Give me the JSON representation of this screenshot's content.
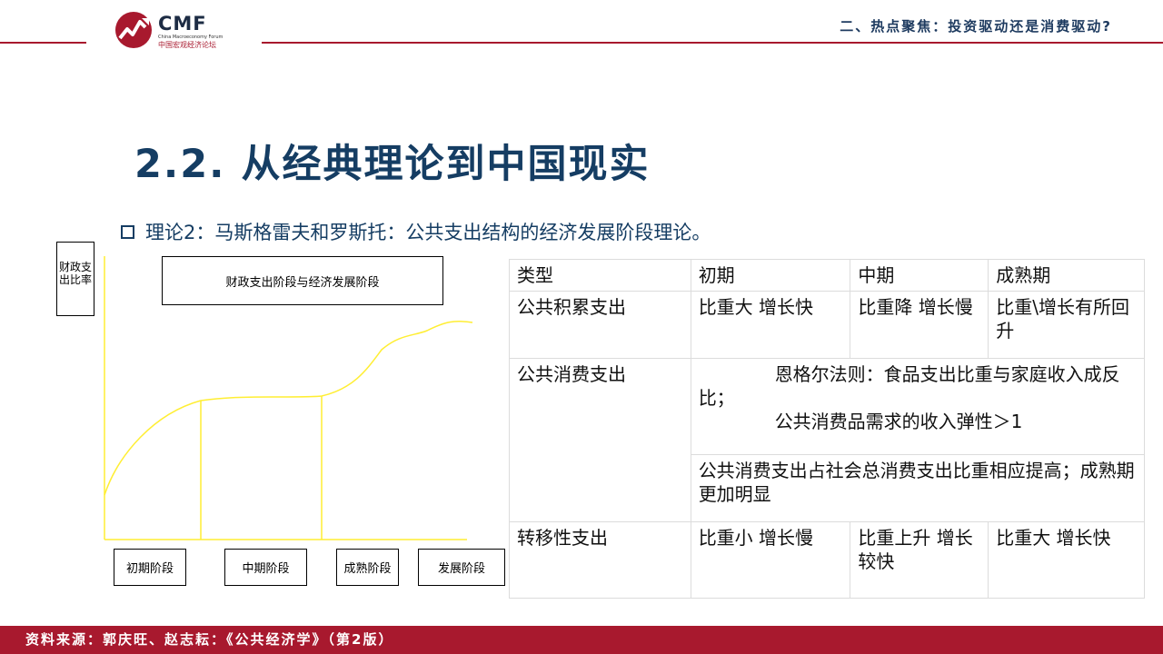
{
  "header": {
    "logo_text": "CMF",
    "logo_subtitle": "China Macroeconomy Forum",
    "logo_chinese": "中国宏观经济论坛",
    "section_title": "二、热点聚焦：投资驱动还是消费驱动?"
  },
  "main": {
    "title": "2.2. 从经典理论到中国现实",
    "bullet": "理论2：马斯格雷夫和罗斯托：公共支出结构的经济发展阶段理论。"
  },
  "diagram": {
    "y_label": "财政支出比率",
    "title": "财政支出阶段与经济发展阶段",
    "stages": [
      "初期阶段",
      "中期阶段",
      "成熟阶段",
      "发展阶段"
    ],
    "curve_color": "#ffee33"
  },
  "table": {
    "headers": [
      "类型",
      "初期",
      "中期",
      "成熟期"
    ],
    "row1": {
      "type": "公共积累支出",
      "early": "比重大 增长快",
      "mid": "比重降 增长慢",
      "mature": "比重\\增长有所回升"
    },
    "row2": {
      "type": "公共消费支出",
      "line1": "恩格尔法则：食品支出比重与家庭收入成反比；",
      "line2": "公共消费品需求的收入弹性＞1",
      "line3": "公共消费支出占社会总消费支出比重相应提高；成熟期更加明显"
    },
    "row3": {
      "type": "转移性支出",
      "early": "比重小 增长慢",
      "mid": "比重上升 增长较快",
      "mature": "比重大 增长快"
    }
  },
  "footer": {
    "source": "资料来源：郭庆旺、赵志耘：《公共经济学》（第2版）"
  },
  "colors": {
    "brand_red": "#a8192e",
    "title_blue": "#153d63"
  }
}
